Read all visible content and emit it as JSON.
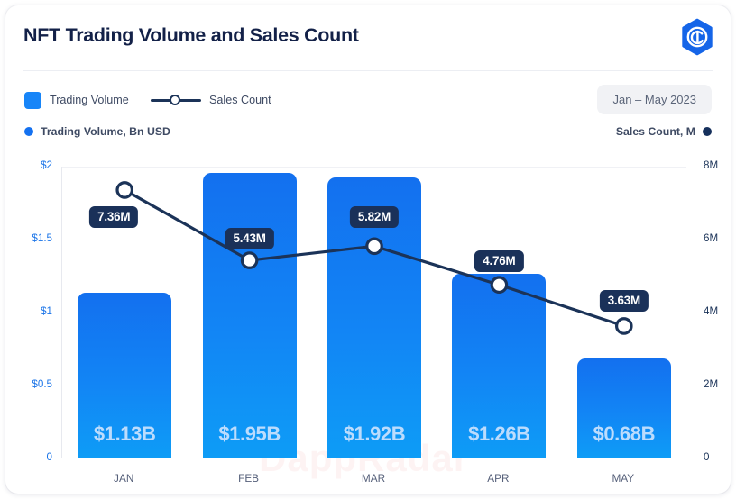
{
  "header": {
    "title": "NFT Trading Volume and Sales Count",
    "logo_icon": "brand-hexagon-spiral-icon"
  },
  "legend": {
    "volume_label": "Trading Volume",
    "sales_label": "Sales Count",
    "volume_swatch_icon": "blue-square-swatch-icon",
    "sales_marker_icon": "line-circle-marker-icon",
    "date_range": "Jan – May 2023"
  },
  "axis_titles": {
    "left": "Trading Volume, Bn USD",
    "right": "Sales Count, M",
    "left_dot_icon": "blue-dot-icon",
    "right_dot_icon": "navy-dot-icon"
  },
  "watermark": "DappRadar",
  "colors": {
    "bar_top": "#1370ef",
    "bar_bottom": "#0e9cf6",
    "line": "#1b3358",
    "label_bg": "#1a3159",
    "left_axis_text": "#1a74e8",
    "right_axis_text": "#1b3358",
    "title": "#132148",
    "badge_bg": "#f1f2f5"
  },
  "chart_data": {
    "type": "bar",
    "title": "NFT Trading Volume and Sales Count",
    "subtitle": "Jan – May 2023",
    "xlabel": "",
    "ylabel": "Trading Volume, Bn USD",
    "y2label": "Sales Count, M",
    "categories": [
      "JAN",
      "FEB",
      "MAR",
      "APR",
      "MAY"
    ],
    "ylim": [
      0,
      2
    ],
    "y2lim": [
      0,
      8000000
    ],
    "yticks": [
      "0",
      "$0.5",
      "$1",
      "$1.5",
      "$2"
    ],
    "ytick_values": [
      0,
      0.5,
      1,
      1.5,
      2
    ],
    "y2ticks": [
      "0",
      "2M",
      "4M",
      "6M",
      "8M"
    ],
    "y2tick_values": [
      0,
      2000000,
      4000000,
      6000000,
      8000000
    ],
    "grid": true,
    "legend_position": "top-left",
    "series": [
      {
        "name": "Trading Volume",
        "type": "bar",
        "axis": "left",
        "unit": "Bn USD",
        "values": [
          1.13,
          1.95,
          1.92,
          1.26,
          0.68
        ],
        "labels": [
          "$1.13B",
          "$1.95B",
          "$1.92B",
          "$1.26B",
          "$0.68B"
        ]
      },
      {
        "name": "Sales Count",
        "type": "line",
        "axis": "right",
        "unit": "M",
        "values": [
          7.36,
          5.43,
          5.82,
          4.76,
          3.63
        ],
        "labels": [
          "7.36M",
          "5.43M",
          "5.82M",
          "4.76M",
          "3.63M"
        ]
      }
    ]
  }
}
